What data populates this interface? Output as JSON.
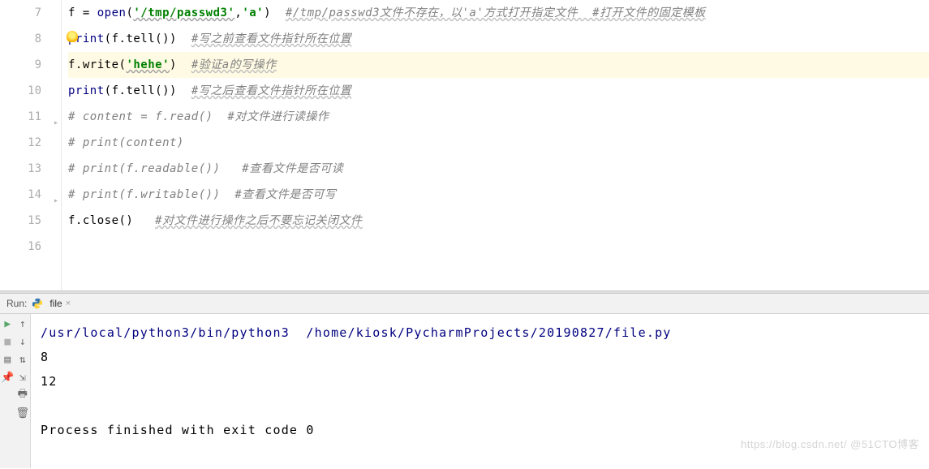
{
  "editor": {
    "highlighted_line": 9,
    "lines": [
      {
        "num": 7
      },
      {
        "num": 8
      },
      {
        "num": 9
      },
      {
        "num": 10
      },
      {
        "num": 11
      },
      {
        "num": 12
      },
      {
        "num": 13
      },
      {
        "num": 14
      },
      {
        "num": 15
      },
      {
        "num": 16
      }
    ],
    "code": {
      "l7": {
        "p1": "f = ",
        "fn": "open",
        "p2": "(",
        "s1": "'/tmp/passwd3'",
        "p3": ",",
        "s2": "'a'",
        "p4": ")  ",
        "c1": "#/tmp/passwd3文件不存在，以'a'方式打开指定文件  #打开文件的固定模板"
      },
      "l8": {
        "fn": "print",
        "p1": "(f.tell())  ",
        "c1": "#写之前查看文件指针所在位置"
      },
      "l9": {
        "p1": "f.write(",
        "s1": "'hehe'",
        "p2": ")  ",
        "c1": "#验证a的写操作"
      },
      "l10": {
        "fn": "print",
        "p1": "(f.tell())  ",
        "c1": "#写之后查看文件指针所在位置"
      },
      "l11": {
        "c1": "# content = f.read()  #对文件进行读操作"
      },
      "l12": {
        "c1": "# print(content)"
      },
      "l13": {
        "c1": "# print(f.readable())   #查看文件是否可读"
      },
      "l14": {
        "c1": "# print(f.writable())  #查看文件是否可写"
      },
      "l15": {
        "p1": "f.close()   ",
        "c1": "#对文件进行操作之后不要忘记关闭文件"
      },
      "l16": {
        "blank": ""
      }
    }
  },
  "run": {
    "label": "Run:",
    "tab": "file",
    "console": {
      "path": "/usr/local/python3/bin/python3  /home/kiosk/PycharmProjects/20190827/file.py",
      "out1": "8",
      "out2": "12",
      "exit": "Process finished with exit code 0"
    }
  },
  "watermark": "https://blog.csdn.net/ @51CTO博客"
}
